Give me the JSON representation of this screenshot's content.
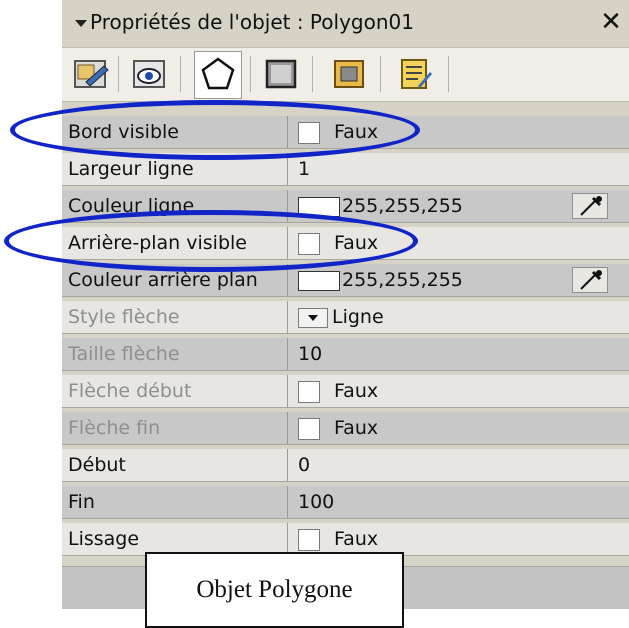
{
  "window": {
    "title": "Propriétés de l'objet : Polygon01",
    "close_icon": "close-icon",
    "collapse_icon": "triangle-down-icon"
  },
  "toolbar": {
    "tabs": [
      {
        "name": "tab-general",
        "icon": "form-edit-icon"
      },
      {
        "name": "tab-visibility",
        "icon": "eye-icon"
      },
      {
        "name": "tab-polygon",
        "icon": "pentagon-icon",
        "active": true
      },
      {
        "name": "tab-window",
        "icon": "window-icon"
      },
      {
        "name": "tab-frame",
        "icon": "frame-icon"
      },
      {
        "name": "tab-notes",
        "icon": "notepad-icon"
      }
    ]
  },
  "properties": [
    {
      "label": "Bord visible",
      "type": "checkbox",
      "value": "Faux",
      "disabled": false
    },
    {
      "label": "Largeur ligne",
      "type": "text",
      "value": "1",
      "disabled": false
    },
    {
      "label": "Couleur ligne",
      "type": "color",
      "value": "255,255,255",
      "disabled": false
    },
    {
      "label": "Arrière-plan visible",
      "type": "checkbox",
      "value": "Faux",
      "disabled": false
    },
    {
      "label": "Couleur arrière plan",
      "type": "color",
      "value": "255,255,255",
      "disabled": false
    },
    {
      "label": "Style flèche",
      "type": "combo",
      "value": "Ligne",
      "disabled": true
    },
    {
      "label": "Taille flèche",
      "type": "text",
      "value": "10",
      "disabled": true
    },
    {
      "label": "Flèche début",
      "type": "checkbox",
      "value": "Faux",
      "disabled": true
    },
    {
      "label": "Flèche fin",
      "type": "checkbox",
      "value": "Faux",
      "disabled": true
    },
    {
      "label": "Début",
      "type": "text",
      "value": "0",
      "disabled": false
    },
    {
      "label": "Fin",
      "type": "text",
      "value": "100",
      "disabled": false
    },
    {
      "label": "Lissage",
      "type": "checkbox",
      "value": "Faux",
      "disabled": false
    }
  ],
  "caption": "Objet Polygone",
  "colors": {
    "highlight_ellipse": "#1124c8",
    "row_odd": "#c8c8c8",
    "row_even": "#e8e6e3",
    "disabled_text": "#8f8f8f"
  }
}
